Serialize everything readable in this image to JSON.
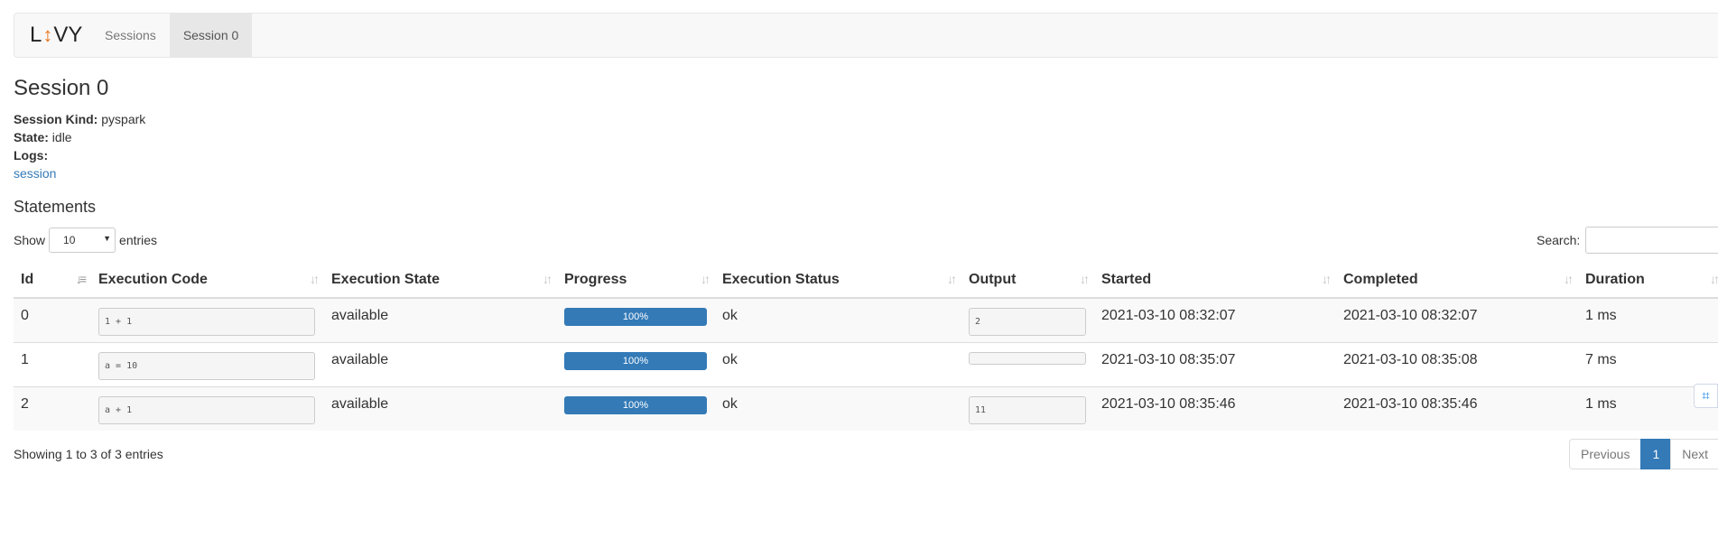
{
  "nav": {
    "brand_left": "L",
    "brand_arrow": "↕",
    "brand_right": "VY",
    "items": [
      {
        "label": "Sessions",
        "active": false
      },
      {
        "label": "Session 0",
        "active": true
      }
    ]
  },
  "session": {
    "title": "Session 0",
    "kind_label": "Session Kind:",
    "kind_value": "pyspark",
    "state_label": "State:",
    "state_value": "idle",
    "logs_label": "Logs:",
    "logs_link": "session"
  },
  "statements": {
    "title": "Statements",
    "show_label": "Show",
    "page_size": "10",
    "entries_label": "entries",
    "search_label": "Search:",
    "search_value": "",
    "columns": [
      "Id",
      "Execution Code",
      "Execution State",
      "Progress",
      "Execution Status",
      "Output",
      "Started",
      "Completed",
      "Duration"
    ],
    "rows": [
      {
        "id": "0",
        "code": "1 + 1",
        "state": "available",
        "progress": "100%",
        "progress_fraction": 1.0,
        "status": "ok",
        "output": "2",
        "started": "2021-03-10 08:32:07",
        "completed": "2021-03-10 08:32:07",
        "duration": "1 ms"
      },
      {
        "id": "1",
        "code": "a = 10",
        "state": "available",
        "progress": "100%",
        "progress_fraction": 1.0,
        "status": "ok",
        "output": "",
        "started": "2021-03-10 08:35:07",
        "completed": "2021-03-10 08:35:08",
        "duration": "7 ms"
      },
      {
        "id": "2",
        "code": "a + 1",
        "state": "available",
        "progress": "100%",
        "progress_fraction": 1.0,
        "status": "ok",
        "output": "11",
        "started": "2021-03-10 08:35:46",
        "completed": "2021-03-10 08:35:46",
        "duration": "1 ms"
      }
    ],
    "info": "Showing 1 to 3 of 3 entries",
    "pagination": {
      "previous": "Previous",
      "current": "1",
      "next": "Next"
    }
  },
  "colors": {
    "accent": "#337ab7",
    "brand_arrow": "#e8751a"
  },
  "float_icon": "translate-icon"
}
